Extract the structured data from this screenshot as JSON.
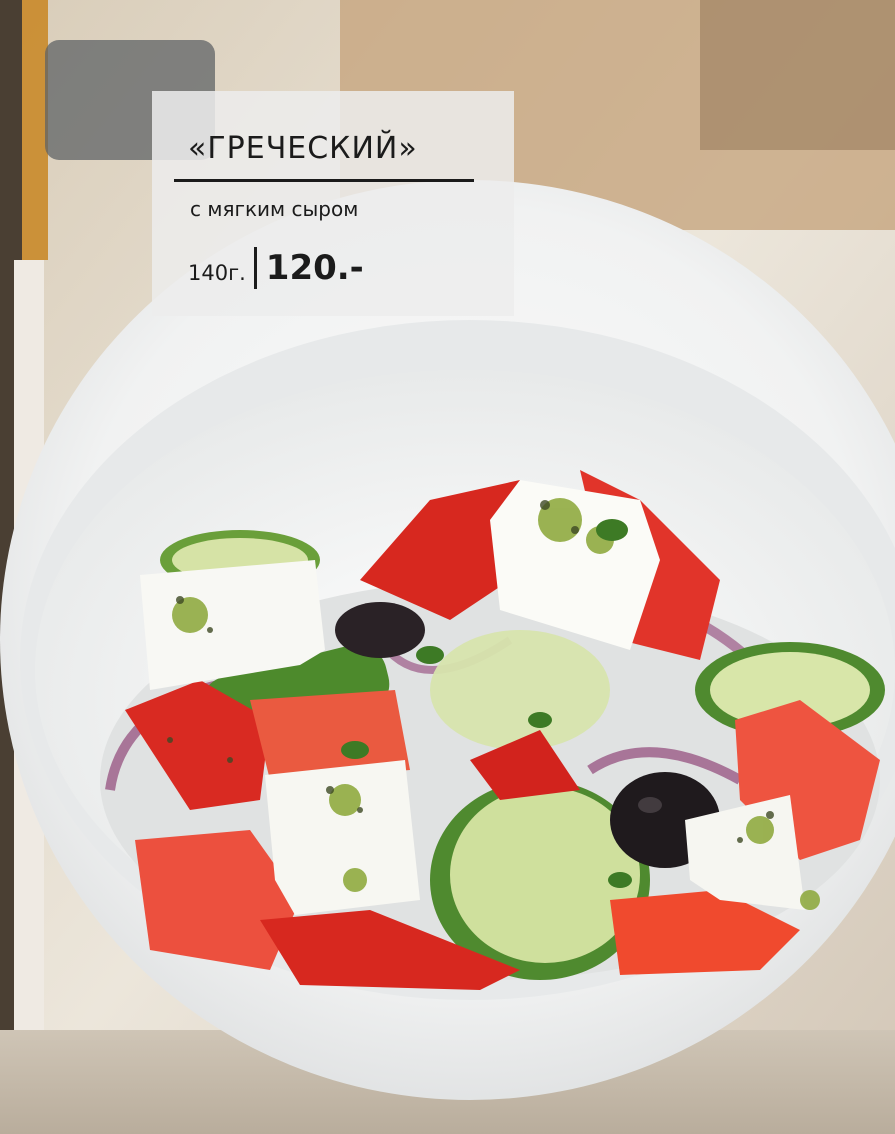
{
  "menu_card": {
    "title": "«ГРЕЧЕСКИЙ»",
    "subtitle": "с мягким сыром",
    "weight": "140г.",
    "price": "120.-"
  },
  "photo": {
    "icon": "greek-salad-photo",
    "colors": {
      "bowl": "#f4f5f5",
      "tomato": "#e8503e",
      "pepper": "#d7281f",
      "cucumber": "#5f9a35",
      "feta": "#f8f8f4",
      "olive": "#1f1a1d",
      "onion": "#9a5a86",
      "table": "#c9beae"
    }
  }
}
